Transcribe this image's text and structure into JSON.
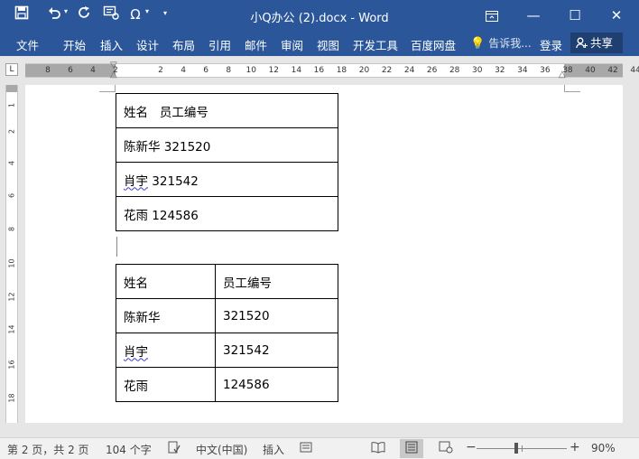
{
  "titlebar": {
    "title": "小Q办公 (2).docx - Word",
    "icons": [
      "save-icon",
      "undo-icon",
      "redo-icon",
      "format-painter-icon",
      "omega-symbol-icon",
      "customize-dropdown-icon"
    ],
    "window_buttons": [
      "ribbon-display-icon",
      "minimize-icon",
      "maximize-icon",
      "close-icon"
    ]
  },
  "ribbon": {
    "tabs": [
      "文件",
      "开始",
      "插入",
      "设计",
      "布局",
      "引用",
      "邮件",
      "审阅",
      "视图",
      "开发工具",
      "百度网盘"
    ],
    "tell_me": "告诉我...",
    "login": "登录",
    "share": "共享"
  },
  "ruler": {
    "corner": "L",
    "ticks": [
      "8",
      "6",
      "4",
      "2",
      "2",
      "4",
      "6",
      "8",
      "10",
      "12",
      "14",
      "16",
      "18",
      "20",
      "22",
      "24",
      "26",
      "28",
      "30",
      "32",
      "34",
      "36",
      "38",
      "40",
      "42",
      "44"
    ],
    "vticks": [
      "1",
      "2",
      "4",
      "6",
      "8",
      "10",
      "12",
      "14",
      "16",
      "18"
    ]
  },
  "document": {
    "table1": {
      "rows": [
        [
          "姓名",
          "员工编号"
        ],
        [
          "陈新华",
          "321520"
        ],
        [
          "肖宇",
          "321542"
        ],
        [
          "花雨",
          "124586"
        ]
      ]
    },
    "table2": {
      "rows": [
        [
          "姓名",
          "员工编号"
        ],
        [
          "陈新华",
          "321520"
        ],
        [
          "肖宇",
          "321542"
        ],
        [
          "花雨",
          "124586"
        ]
      ]
    }
  },
  "statusbar": {
    "page": "第 2 页，共 2 页",
    "words": "104 个字",
    "language": "中文(中国)",
    "mode": "插入",
    "zoom": "90%",
    "zoom_value": 90,
    "colors": {
      "accent": "#2b579a",
      "share_bg": "#1e3f70"
    }
  }
}
